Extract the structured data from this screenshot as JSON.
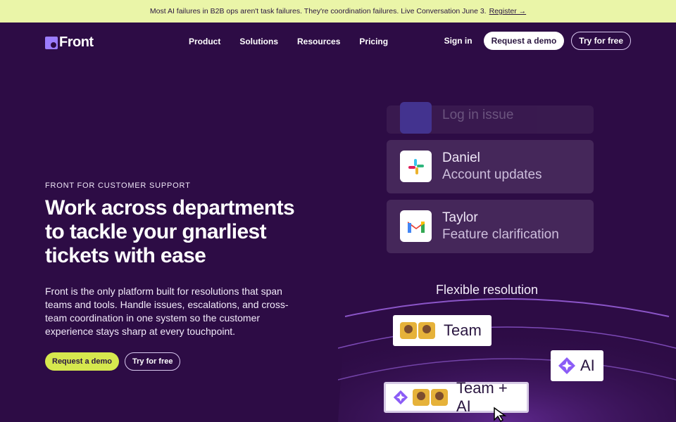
{
  "banner": {
    "text": "Most AI failures in B2B ops aren't task failures. They're coordination failures. Live Conversation June 3.",
    "link": "Register →"
  },
  "nav": {
    "logo": "Front",
    "links": [
      "Product",
      "Solutions",
      "Resources",
      "Pricing"
    ],
    "signin": "Sign in",
    "request_demo": "Request a demo",
    "try_free": "Try for free"
  },
  "hero": {
    "eyebrow": "FRONT FOR CUSTOMER SUPPORT",
    "headline": "Work across departments to tackle your gnarliest tickets with ease",
    "body": "Front is the only platform built for resolutions that span teams and tools. Handle issues, escalations, and cross-team coordination in one system so the customer experience stays sharp at every touchpoint.",
    "cta_primary": "Request a demo",
    "cta_secondary": "Try for free"
  },
  "cards": [
    {
      "title": "",
      "subtitle": "Log in issue",
      "icon": "app-icon"
    },
    {
      "title": "Daniel",
      "subtitle": "Account updates",
      "icon": "slack-icon"
    },
    {
      "title": "Taylor",
      "subtitle": "Feature clarification",
      "icon": "gmail-icon"
    }
  ],
  "resolution": {
    "title": "Flexible resolution",
    "team": "Team",
    "ai": "AI",
    "team_ai": "Team + AI"
  },
  "colors": {
    "background": "#2d0c45",
    "banner": "#eaf5a8",
    "accent": "#d6e84e",
    "ai_purple": "#8b5cf6"
  }
}
